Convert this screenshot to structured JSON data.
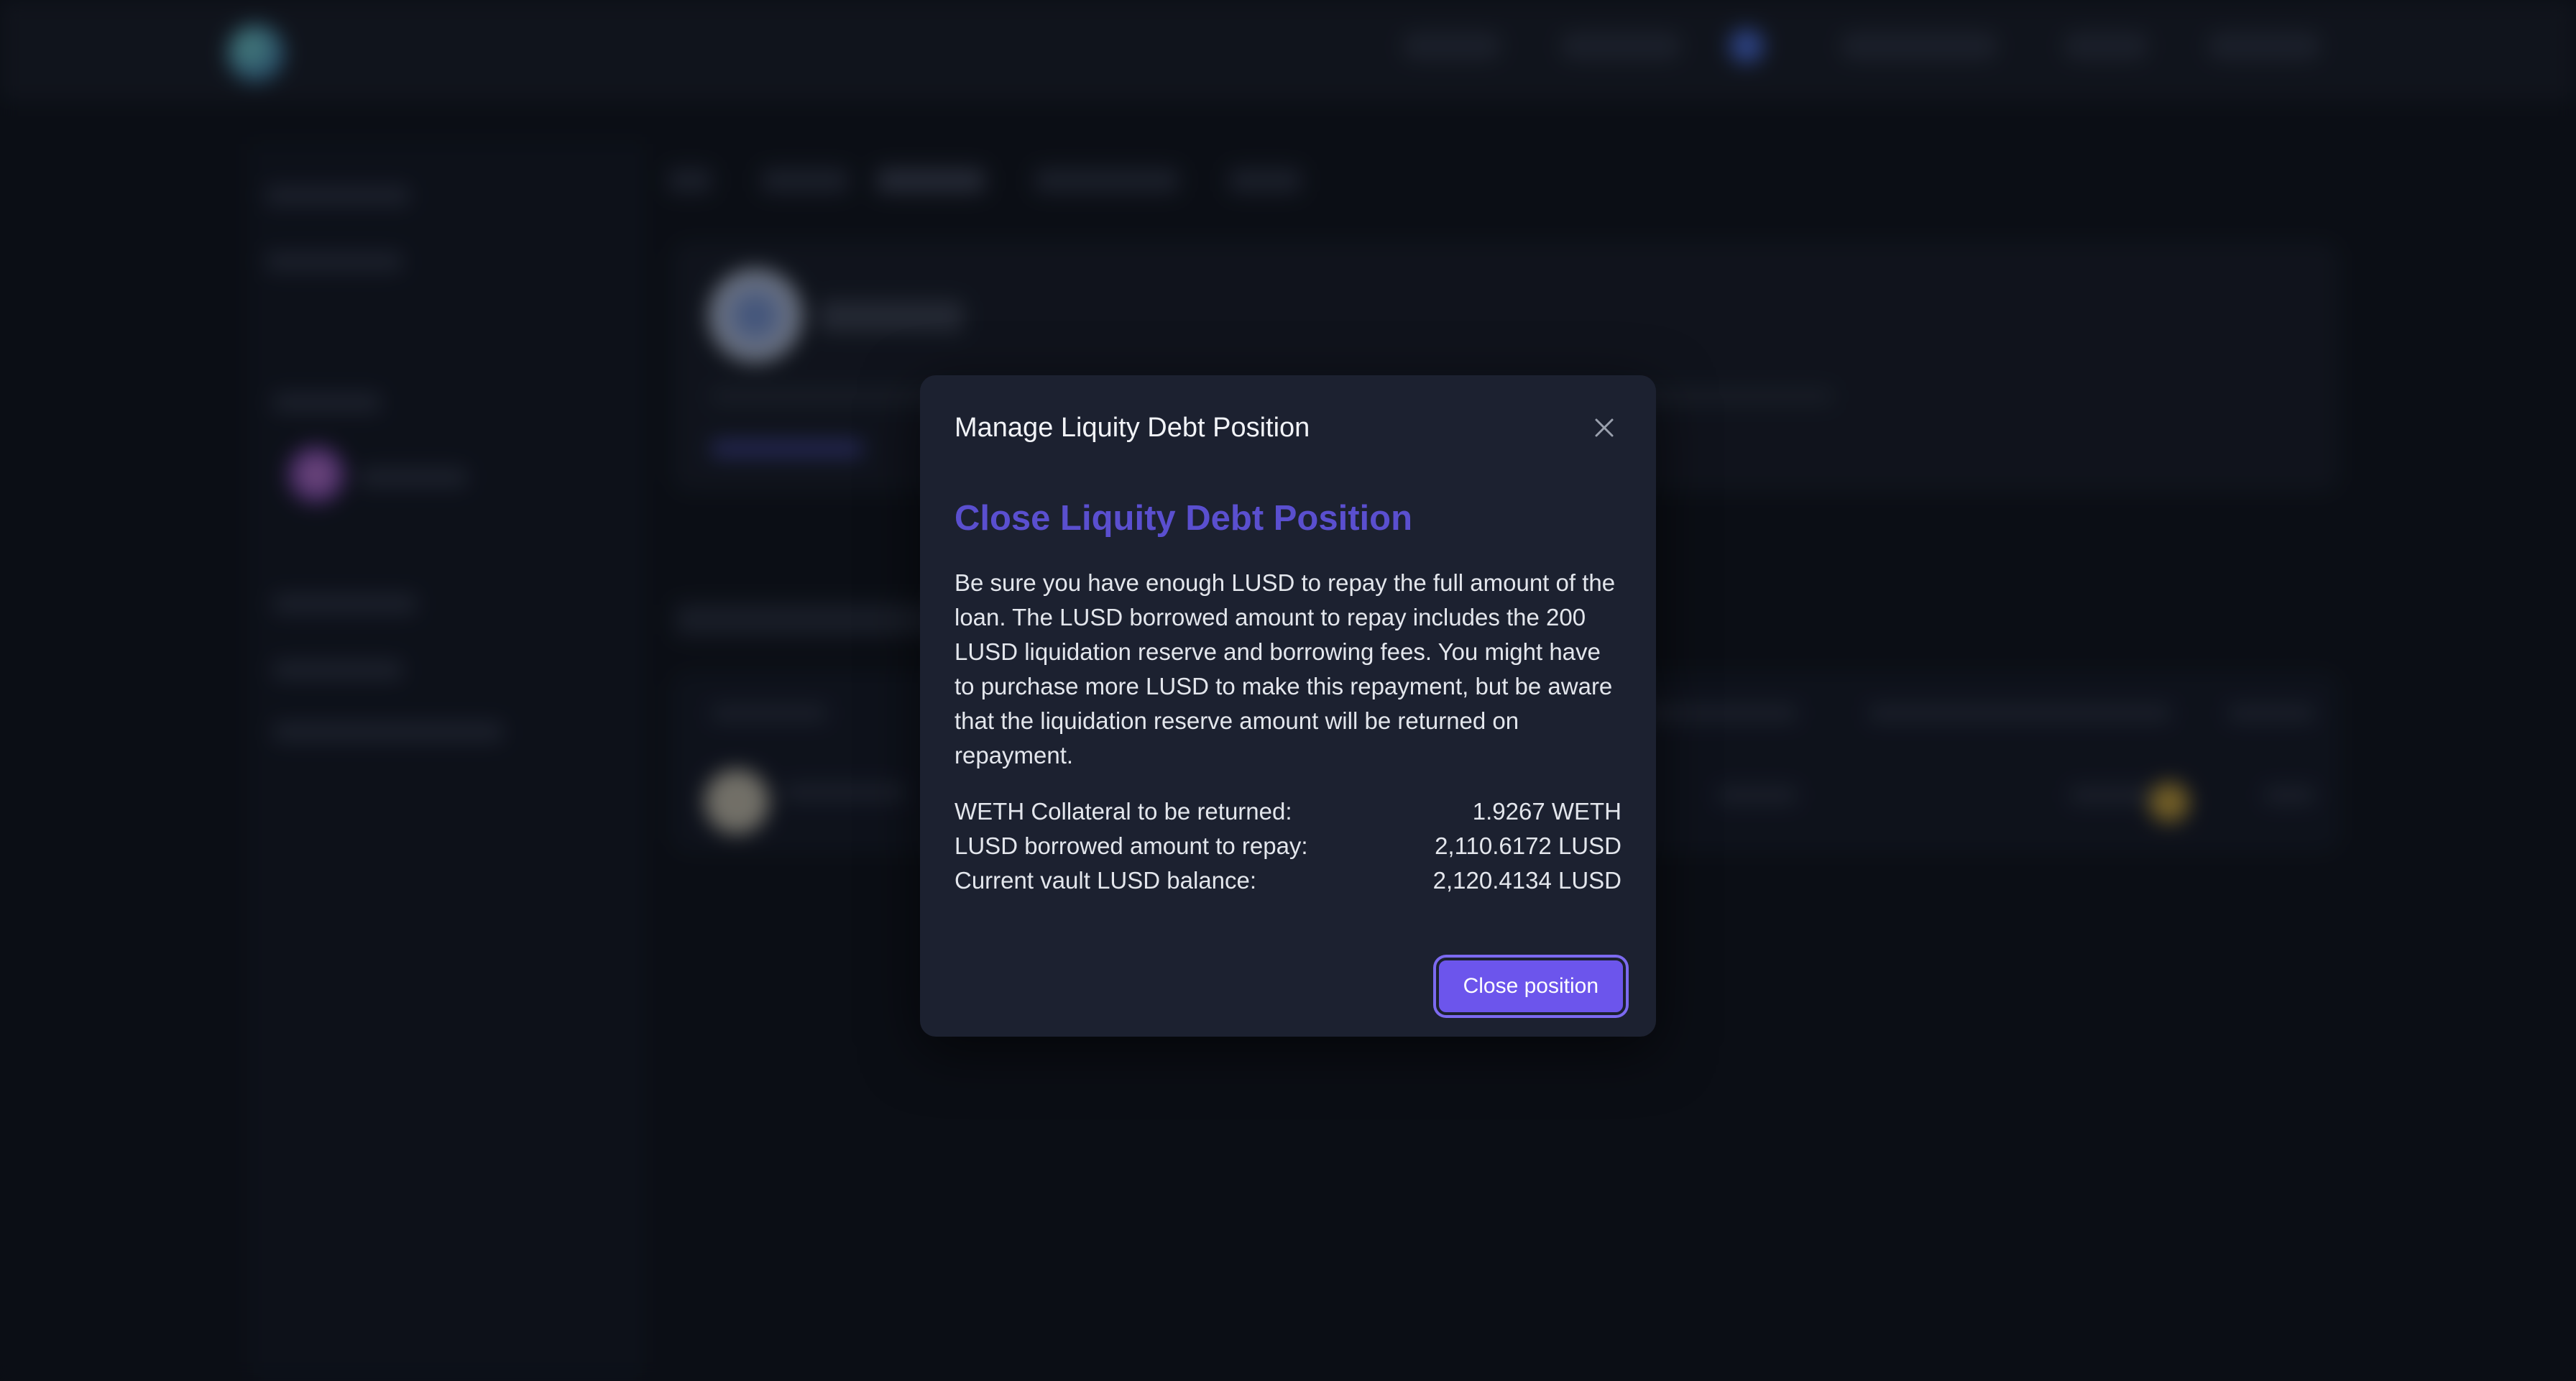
{
  "modal": {
    "title": "Manage Liquity Debt Position",
    "heading": "Close Liquity Debt Position",
    "description": "Be sure you have enough LUSD to repay the full amount of the loan. The LUSD borrowed amount to repay includes the 200 LUSD liquidation reserve and borrowing fees. You might have to purchase more LUSD to make this repayment, but be aware that the liquidation reserve amount will be returned on repayment.",
    "rows": [
      {
        "label": "WETH Collateral to be returned:",
        "value": "1.9267 WETH"
      },
      {
        "label": "LUSD borrowed amount to repay:",
        "value": "2,110.6172 LUSD"
      },
      {
        "label": "Current vault LUSD balance:",
        "value": "2,120.4134 LUSD"
      }
    ],
    "primary_button_label": "Close position",
    "close_icon": "close-icon"
  },
  "colors": {
    "accent": "#6c55ec",
    "heading": "#5a4fcf",
    "modal_bg": "#1c2130",
    "page_bg": "#0d111a"
  }
}
